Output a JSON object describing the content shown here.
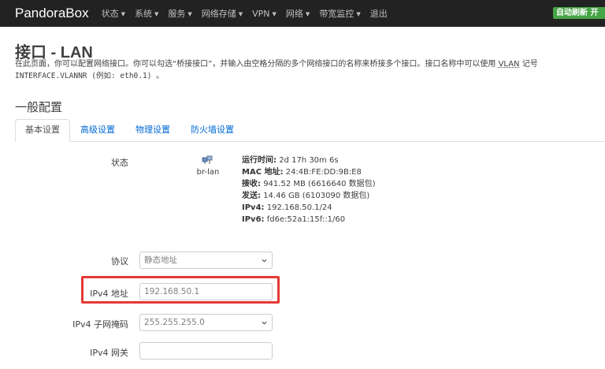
{
  "navbar": {
    "brand": "PandoraBox",
    "menu": [
      {
        "label": "状态",
        "has_caret": true
      },
      {
        "label": "系统",
        "has_caret": true
      },
      {
        "label": "服务",
        "has_caret": true
      },
      {
        "label": "网络存储",
        "has_caret": true
      },
      {
        "label": "VPN",
        "has_caret": true
      },
      {
        "label": "网络",
        "has_caret": true
      },
      {
        "label": "带宽监控",
        "has_caret": true
      },
      {
        "label": "退出",
        "has_caret": false
      }
    ],
    "caret_glyph": "▼",
    "autorefresh_label": "自动刷新 开"
  },
  "page": {
    "title": "接口 - LAN",
    "desc_part1": "在此页面，你可以配置网络接口。你可以勾选“桥接接口”，并输入由空格分隔的多个网络接口的名称来桥接多个接口。接口名称中可以使用",
    "desc_abbr": "VLAN",
    "desc_part2": "记号",
    "desc_line2": "INTERFACE.VLANNR (例如: eth0.1) 。",
    "section_title": "一般配置"
  },
  "tabs": [
    "基本设置",
    "高级设置",
    "物理设置",
    "防火墙设置"
  ],
  "status": {
    "label": "状态",
    "interface_name": "br-lan",
    "uptime_label": "运行时间:",
    "uptime_value": "2d 17h 30m 6s",
    "mac_label": "MAC 地址:",
    "mac_value": "24:4B:FE:DD:9B:E8",
    "rx_label": "接收:",
    "rx_value": "941.52 MB (6616640 数据包)",
    "tx_label": "发送:",
    "tx_value": "14.46 GB (6103090 数据包)",
    "ipv4_label": "IPv4:",
    "ipv4_value": "192.168.50.1/24",
    "ipv6_label": "IPv6:",
    "ipv6_value": "fd6e:52a1:15f::1/60"
  },
  "form": {
    "protocol_label": "协议",
    "protocol_value": "静态地址",
    "ipv4_addr_label": "IPv4 地址",
    "ipv4_addr_value": "192.168.50.1",
    "netmask_label": "IPv4 子网掩码",
    "netmask_value": "255.255.255.0",
    "gateway_label": "IPv4 网关",
    "gateway_value": ""
  },
  "colors": {
    "navbar_bg": "#222222",
    "autorefresh_bg": "#46a546",
    "link": "#0069d6",
    "highlight": "#e53935"
  },
  "icons": {
    "interface": "network-interface-icon",
    "select": "chevron-down-icon"
  }
}
